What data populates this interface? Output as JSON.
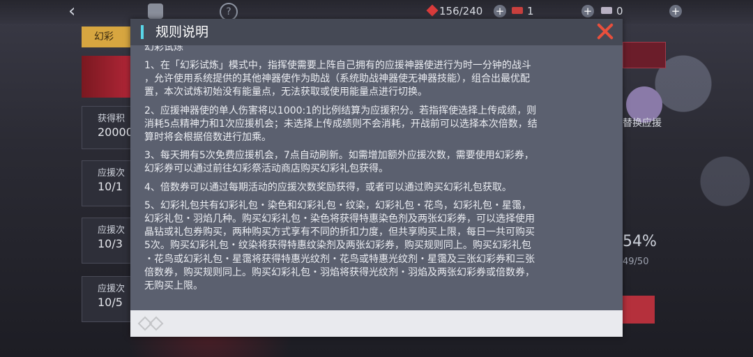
{
  "topbar": {
    "stamina": "156/240",
    "tickets": "1",
    "currency": "0",
    "help_glyph": "?",
    "icons": [
      "back-arrow-icon",
      "city-icon",
      "help-icon",
      "gem-icon",
      "add-icon",
      "ticket-icon",
      "add-icon",
      "item-icon",
      "add-icon"
    ]
  },
  "background": {
    "left_tab": "幻彩",
    "cards": [
      {
        "label": "获得积",
        "value": "20000"
      },
      {
        "label": "应援次",
        "value": "10/1"
      },
      {
        "label": "应援次",
        "value": "10/3"
      },
      {
        "label": "应援次",
        "value": "10/5"
      }
    ],
    "switch_label": "替换应援",
    "percent": "54%",
    "percent_sub": "49/50"
  },
  "modal": {
    "title": "规则说明",
    "partial_heading": "幻彩试炼",
    "rules": [
      "1、在「幻彩试炼」模式中，指挥使需要上阵自己拥有的应援神器使进行为时一分钟的战斗\n，允许使用系统提供的其他神器使作为助战（系统助战神器使无神器技能），组合出最优配\n置，本次试炼初始没有能量点，无法获取或使用能量点进行切换。",
      "2、应援神器使的单人伤害将以1000:1的比例结算为应援积分。若指挥使选择上传成绩，则\n消耗5点精神力和1次应援机会；未选择上传成绩则不会消耗，开战前可以选择本次倍数，结\n算时将会根据倍数进行加乘。",
      "3、每天拥有5次免费应援机会，7点自动刷新。如需增加额外应援次数，需要使用幻彩券，\n幻彩券可以通过前往幻彩祭活动商店购买幻彩礼包获得。",
      "4、倍数券可以通过每期活动的应援次数奖励获得，或者可以通过购买幻彩礼包获取。",
      "5、幻彩礼包共有幻彩礼包・染色和幻彩礼包・纹染，幻彩礼包・花鸟，幻彩礼包・星霭，\n幻彩礼包・羽焰几种。购买幻彩礼包・染色将获得特惠染色剂及两张幻彩券，可以选择使用\n晶钻或礼包券购买，两种购买方式享有不同的折扣力度，但共享购买上限，每日一共可购买\n5次。购买幻彩礼包・纹染将获得特惠纹染剂及两张幻彩券，购买规则同上。购买幻彩礼包\n・花鸟或幻彩礼包・星霭将获得特惠光纹剂・花鸟或特惠光纹剂・星霭及三张幻彩券和三张\n倍数券，购买规则同上。购买幻彩礼包・羽焰将获得光纹剂・羽焰及两张幻彩券或倍数券，\n无购买上限。"
    ]
  }
}
